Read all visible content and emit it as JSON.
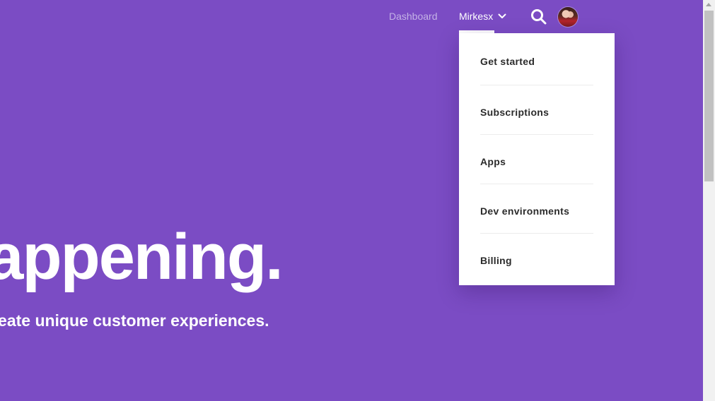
{
  "nav": {
    "dashboard_label": "Dashboard",
    "account_label": "Mirkesx",
    "search_icon": "search-icon",
    "avatar_icon": "user-avatar"
  },
  "hero": {
    "title": "happening.",
    "subtitle": "and create unique customer experiences."
  },
  "dropdown": {
    "items": [
      {
        "label": "Get started"
      },
      {
        "label": "Subscriptions"
      },
      {
        "label": "Apps"
      },
      {
        "label": "Dev environments"
      },
      {
        "label": "Billing"
      }
    ]
  },
  "colors": {
    "background": "#7b4cc4",
    "dashboard_link": "#c4b2e6",
    "dropdown_bg": "#ffffff",
    "menu_text": "#2b2b2b"
  }
}
